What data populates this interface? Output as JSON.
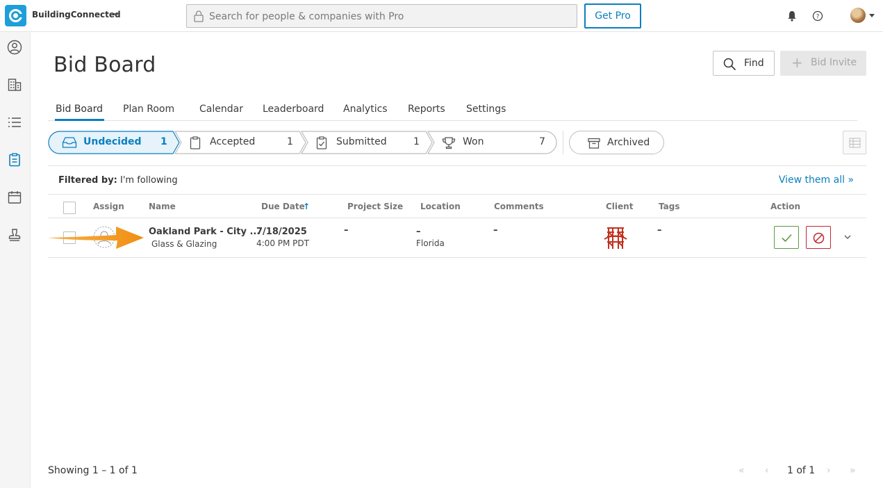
{
  "app": {
    "brand": "BuildingConnected",
    "search_placeholder": "Search for people & companies with Pro",
    "get_pro": "Get Pro"
  },
  "page": {
    "title": "Bid Board",
    "find_label": "Find",
    "bid_invite_label": "Bid Invite"
  },
  "tabs": [
    {
      "label": "Bid Board",
      "active": true
    },
    {
      "label": "Plan Room"
    },
    {
      "label": "Calendar"
    },
    {
      "label": "Leaderboard"
    },
    {
      "label": "Analytics"
    },
    {
      "label": "Reports"
    },
    {
      "label": "Settings"
    }
  ],
  "statuses": [
    {
      "label": "Undecided",
      "count": "1",
      "active": true,
      "icon": "inbox-icon"
    },
    {
      "label": "Accepted",
      "count": "1",
      "icon": "clipboard-icon"
    },
    {
      "label": "Submitted",
      "count": "1",
      "icon": "clipboard-check-icon"
    },
    {
      "label": "Won",
      "count": "7",
      "icon": "trophy-icon"
    }
  ],
  "archived_label": "Archived",
  "filter": {
    "prefix": "Filtered by:",
    "value": "I'm following",
    "view_all": "View them all »"
  },
  "columns": {
    "assign": "Assign",
    "name": "Name",
    "due_date": "Due Date",
    "due_sort": "↑",
    "project_size": "Project Size",
    "location": "Location",
    "comments": "Comments",
    "client": "Client",
    "tags": "Tags",
    "action": "Action"
  },
  "rows": [
    {
      "name": "Oakland Park - City ...",
      "trade": "Glass & Glazing",
      "due_date": "7/18/2025",
      "due_time": "4:00 PM PDT",
      "project_size": "–",
      "location_top": "–",
      "location": "Florida",
      "comments": "–",
      "tags": "–"
    }
  ],
  "footer": {
    "showing": "Showing 1 – 1 of 1",
    "page": "1 of 1",
    "first": "«",
    "prev": "‹",
    "next": "›",
    "last": "»"
  },
  "colors": {
    "accent": "#0a7fbf",
    "accept": "#5a9a3c",
    "decline": "#c4262e",
    "annotation_arrow": "#f39a21"
  }
}
